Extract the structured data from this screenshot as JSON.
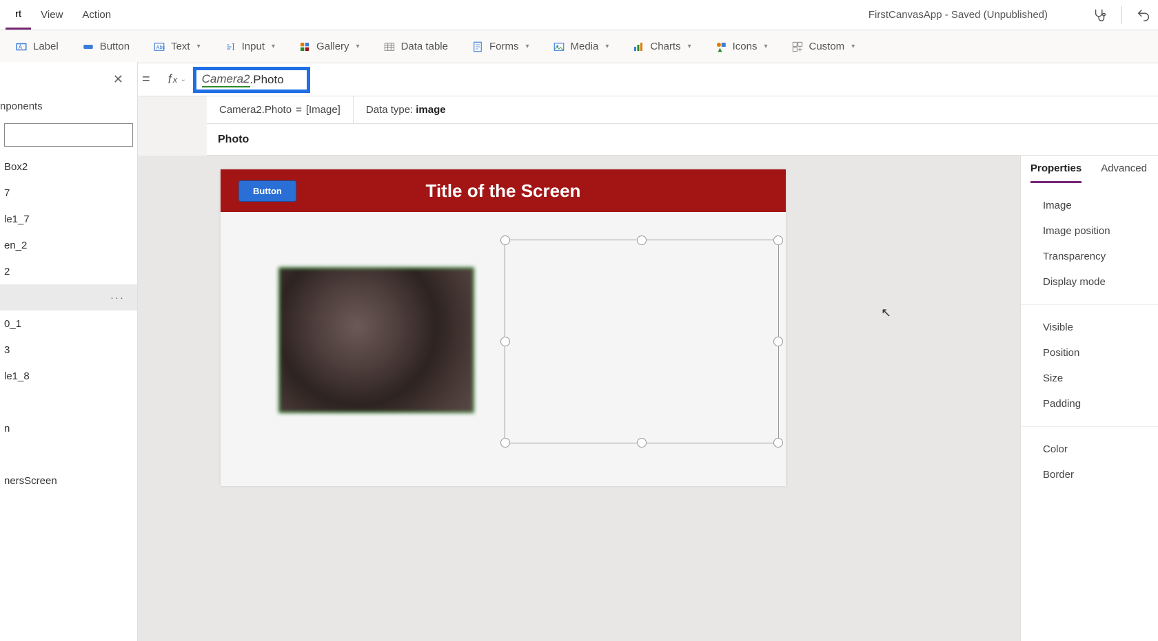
{
  "menubar": {
    "items": [
      "rt",
      "View",
      "Action"
    ],
    "status": "FirstCanvasApp - Saved (Unpublished)"
  },
  "ribbon": {
    "label_btn": "Label",
    "button_btn": "Button",
    "text_btn": "Text",
    "input_btn": "Input",
    "gallery_btn": "Gallery",
    "datatable_btn": "Data table",
    "forms_btn": "Forms",
    "media_btn": "Media",
    "charts_btn": "Charts",
    "icons_btn": "Icons",
    "custom_btn": "Custom"
  },
  "formulabar": {
    "ref": "Camera2",
    "suffix": ".Photo",
    "eval_lhs": "Camera2.Photo",
    "eval_rhs": "[Image]",
    "datatype_label": "Data type:",
    "datatype_value": "image",
    "prop_label": "Photo"
  },
  "tree": {
    "tab": "nponents",
    "items": [
      "Box2",
      "7",
      "le1_7",
      "en_2",
      "2",
      "",
      "0_1",
      "3",
      "le1_8",
      "",
      "n",
      "",
      "nersScreen"
    ],
    "selected_index": 5
  },
  "canvas": {
    "title": "Title of the Screen",
    "button_label": "Button"
  },
  "props": {
    "tabs": [
      "Properties",
      "Advanced"
    ],
    "rows_a": [
      "Image",
      "Image position",
      "Transparency",
      "Display mode"
    ],
    "rows_b": [
      "Visible",
      "Position",
      "Size",
      "Padding"
    ],
    "rows_c": [
      "Color",
      "Border"
    ]
  }
}
